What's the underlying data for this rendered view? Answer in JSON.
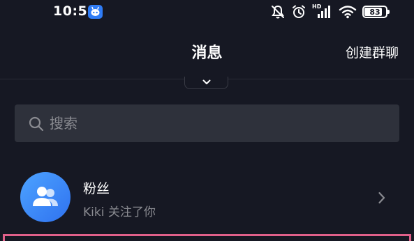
{
  "status_bar": {
    "time": "10:51",
    "app_icon": "bot-app-icon",
    "network_label": "HD",
    "battery": "83",
    "battery_level_percent": 83,
    "icons": [
      "mute-icon",
      "alarm-icon",
      "signal-icon",
      "wifi-icon",
      "battery-icon"
    ]
  },
  "header": {
    "title": "消息",
    "create_group": "创建群聊"
  },
  "search": {
    "placeholder": "搜索",
    "value": ""
  },
  "messages": [
    {
      "title": "粉丝",
      "subtitle": "Kiki 关注了你",
      "avatar_icon": "fans-group-icon",
      "avatar_color": "#3d8cf8"
    }
  ],
  "colors": {
    "background": "#161823",
    "search_bg": "#2e313b",
    "secondary_text": "#8a8b91",
    "highlight": "#e0608a"
  }
}
